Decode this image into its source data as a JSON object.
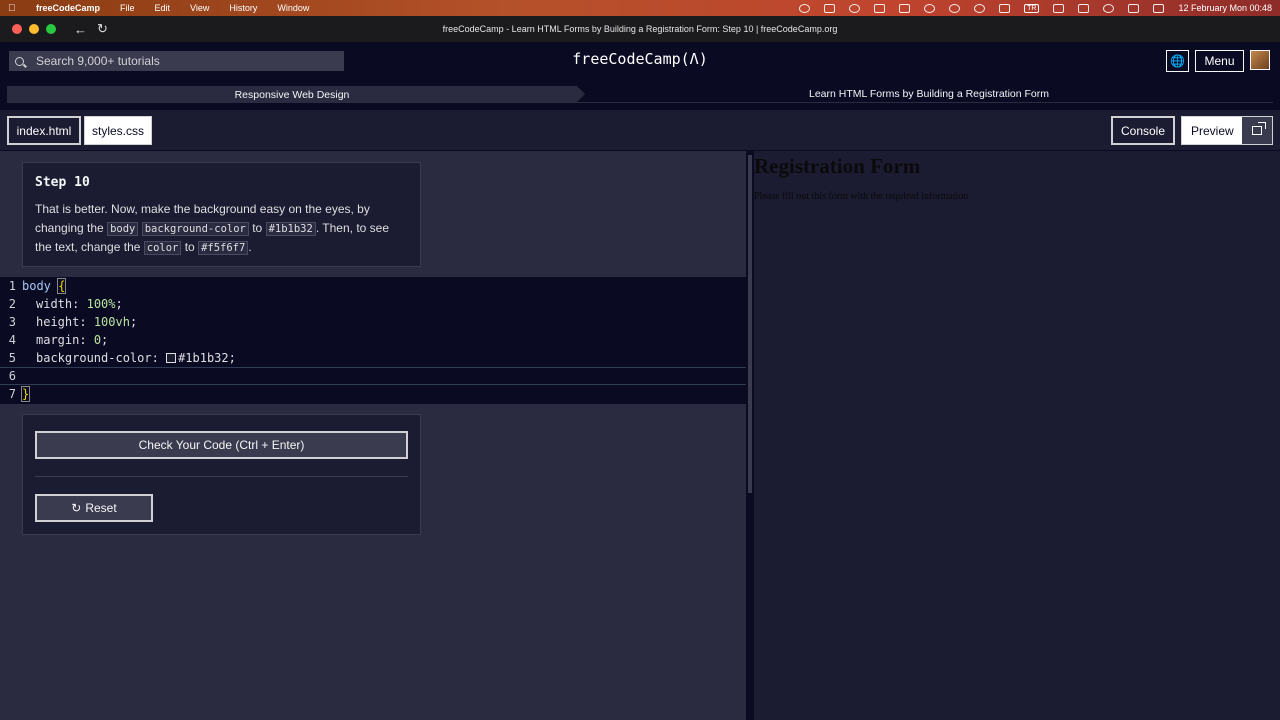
{
  "menubar": {
    "app_name": "freeCodeCamp",
    "items": [
      "File",
      "Edit",
      "View",
      "History",
      "Window"
    ],
    "input_lang": "TR",
    "datetime": "12 February Mon  00:48"
  },
  "window": {
    "title": "freeCodeCamp - Learn HTML Forms by Building a Registration Form: Step 10 | freeCodeCamp.org"
  },
  "nav": {
    "search_placeholder": "Search 9,000+ tutorials",
    "logo": "freeCodeCamp(🔥)",
    "logo_text": "freeCodeCamp",
    "menu_label": "Menu"
  },
  "breadcrumb": {
    "superblock": "Responsive Web Design",
    "block": "Learn HTML Forms by Building a Registration Form"
  },
  "tabs": {
    "index": "index.html",
    "styles": "styles.css",
    "console": "Console",
    "preview": "Preview"
  },
  "step": {
    "title": "Step 10",
    "text_1": "That is better. Now, make the background easy on the eyes, by changing the",
    "code_body": "body",
    "code_bgcolor": "background-color",
    "text_to": "to",
    "code_color_value": "#1b1b32",
    "text_2": ". Then, to see the text, change the",
    "code_color": "color",
    "text_to2": "to",
    "code_text_value": "#f5f6f7",
    "text_end": "."
  },
  "editor": {
    "line_numbers": [
      "1",
      "2",
      "3",
      "4",
      "5",
      "6",
      "7"
    ],
    "l1_selector": "body",
    "l1_brace": "{",
    "l2_prop": "width:",
    "l2_val": "100%",
    "l3_prop": "height:",
    "l3_val": "100vh",
    "l4_prop": "margin:",
    "l4_val": "0",
    "l5_prop": "background-color:",
    "l5_val": "#1b1b32",
    "semicolon": ";",
    "l7_brace": "}",
    "swatch_color": "#1b1b32"
  },
  "buttons": {
    "check": "Check Your Code (Ctrl + Enter)",
    "reset": "Reset"
  },
  "preview": {
    "heading": "Registration Form",
    "paragraph": "Please fill out this form with the required information"
  }
}
